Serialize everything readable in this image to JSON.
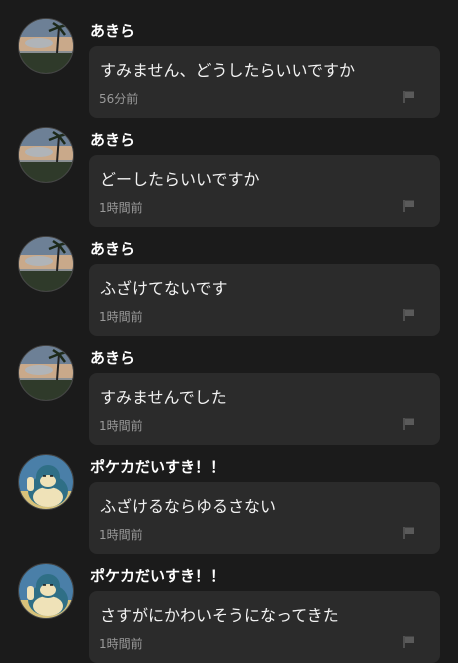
{
  "messages": [
    {
      "avatar": "sunset-palm-avatar",
      "name": "あきら",
      "text": "すみません、どうしたらいいですか",
      "time": "56分前",
      "icon": "flag-icon"
    },
    {
      "avatar": "sunset-palm-avatar",
      "name": "あきら",
      "text": "どーしたらいいですか",
      "time": "1時間前",
      "icon": "flag-icon"
    },
    {
      "avatar": "sunset-palm-avatar",
      "name": "あきら",
      "text": "ふざけてないです",
      "time": "1時間前",
      "icon": "flag-icon"
    },
    {
      "avatar": "sunset-palm-avatar",
      "name": "あきら",
      "text": "すみませんでした",
      "time": "1時間前",
      "icon": "flag-icon"
    },
    {
      "avatar": "snorlax-avatar",
      "name": "ポケカだいすき！！",
      "text": "ふざけるならゆるさない",
      "time": "1時間前",
      "icon": "flag-icon"
    },
    {
      "avatar": "snorlax-avatar",
      "name": "ポケカだいすき！！",
      "text": "さすがにかわいそうになってきた",
      "time": "1時間前",
      "icon": "flag-icon"
    }
  ]
}
